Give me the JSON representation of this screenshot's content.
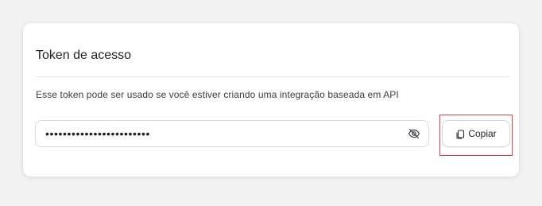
{
  "card": {
    "title": "Token de acesso",
    "description": "Esse token pode ser usado se você estiver criando uma integração baseada em API"
  },
  "token_field": {
    "masked_value": "••••••••••••••••••••••••",
    "visibility_icon": "eye-off-icon"
  },
  "copy_button": {
    "label": "Copiar",
    "icon": "copy-icon"
  },
  "colors": {
    "highlight_border": "#d9434c",
    "text_primary": "#222326",
    "border": "#dcdce0"
  }
}
